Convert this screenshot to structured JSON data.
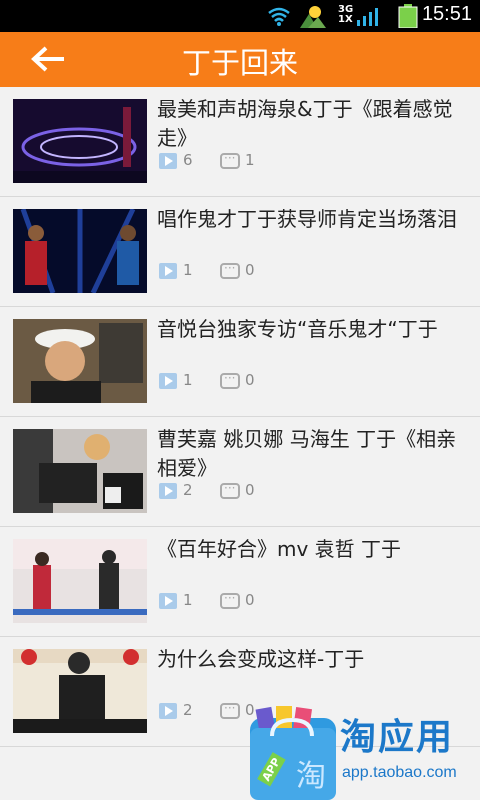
{
  "status": {
    "time": "15:51",
    "network": "3G\n1X"
  },
  "header": {
    "title": "丁于回来"
  },
  "items": [
    {
      "title": "最美和声胡海泉&丁于《跟着感觉走》",
      "plays": "6",
      "comments": "1",
      "thumb": "stage-purple"
    },
    {
      "title": "唱作鬼才丁于获导师肯定当场落泪",
      "plays": "1",
      "comments": "0",
      "thumb": "stage-blue"
    },
    {
      "title": "音悦台独家专访“音乐鬼才“丁于",
      "plays": "1",
      "comments": "0",
      "thumb": "portrait-cap"
    },
    {
      "title": "曹芙嘉 姚贝娜 马海生 丁于《相亲相爱》",
      "plays": "2",
      "comments": "0",
      "thumb": "studio"
    },
    {
      "title": "《百年好合》mv 袁哲 丁于",
      "plays": "1",
      "comments": "0",
      "thumb": "street"
    },
    {
      "title": "为什么会变成这样-丁于",
      "plays": "2",
      "comments": "0",
      "thumb": "chart-show"
    }
  ],
  "promo": {
    "name": "淘应用",
    "url": "app.taobao.com",
    "badge": "APP"
  }
}
